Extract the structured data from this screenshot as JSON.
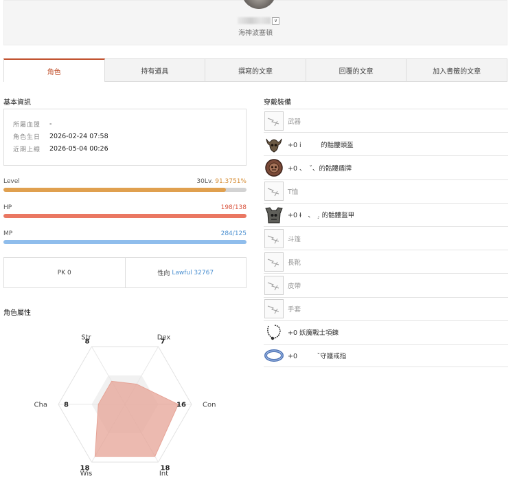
{
  "header": {
    "server": "海神波塞頓",
    "dropdown_glyph": "∨"
  },
  "tabs": [
    {
      "label": "角色",
      "active": true
    },
    {
      "label": "持有道具",
      "active": false
    },
    {
      "label": "撰寫的文章",
      "active": false
    },
    {
      "label": "回覆的文章",
      "active": false
    },
    {
      "label": "加入書籤的文章",
      "active": false
    }
  ],
  "basic_info": {
    "title": "基本資訊",
    "rows": [
      {
        "label": "所屬血盟",
        "value": "-"
      },
      {
        "label": "角色生日",
        "value": "2026-02-24 07:58"
      },
      {
        "label": "近期上線",
        "value": "2026-05-04 00:26"
      }
    ]
  },
  "bars": {
    "level": {
      "label": "Level",
      "value_prefix": "30Lv.",
      "value": "91.3751%",
      "fill": 0.914,
      "color": "#e0a04f"
    },
    "hp": {
      "label": "HP",
      "value": "198/138",
      "fill": 1.0,
      "color": "#ea7762"
    },
    "mp": {
      "label": "MP",
      "value": "284/125",
      "fill": 1.0,
      "color": "#8fbdec"
    }
  },
  "pk": {
    "pk_label": "PK 0",
    "align_label": "性向",
    "align_value": "Lawful 32767"
  },
  "stats": {
    "title": "角色屬性",
    "max": 20,
    "items": [
      {
        "name": "Str",
        "value": 8
      },
      {
        "name": "Dex",
        "value": 7
      },
      {
        "name": "Con",
        "value": 16
      },
      {
        "name": "Int",
        "value": 18
      },
      {
        "name": "Wis",
        "value": 18
      },
      {
        "name": "Cha",
        "value": 8
      }
    ],
    "fill_color": "#e6a396"
  },
  "equipment": {
    "title": "穿戴裝備",
    "items": [
      {
        "icon": "empty-slot-icon",
        "text": "武器",
        "empty": true
      },
      {
        "icon": "skull-helmet-icon",
        "text": "+0 i　　　的骷髏頭盔",
        "empty": false
      },
      {
        "icon": "skull-shield-icon",
        "text": "+0 、　ˇ、的骷髏盾牌",
        "empty": false
      },
      {
        "icon": "empty-slot-icon",
        "text": "T恤",
        "empty": true
      },
      {
        "icon": "skull-armor-icon",
        "text": "+0 Ɨ　、　.̣ 的骷髏盔甲",
        "empty": false
      },
      {
        "icon": "empty-slot-icon",
        "text": "斗篷",
        "empty": true
      },
      {
        "icon": "empty-slot-icon",
        "text": "長靴",
        "empty": true
      },
      {
        "icon": "empty-slot-icon",
        "text": "皮帶",
        "empty": true
      },
      {
        "icon": "empty-slot-icon",
        "text": "手套",
        "empty": true
      },
      {
        "icon": "necklace-icon",
        "text": "+0 妖魔戰士項鍊",
        "empty": false
      },
      {
        "icon": "ring-icon",
        "text": "+0　　　ˇ守護戒指",
        "empty": false
      }
    ]
  }
}
